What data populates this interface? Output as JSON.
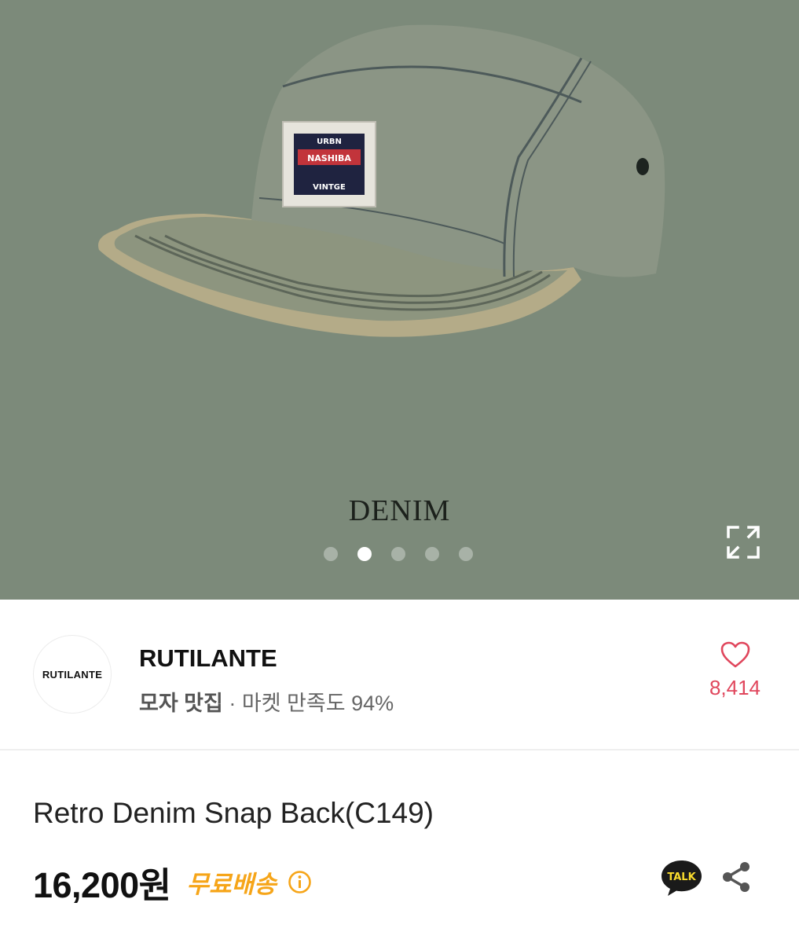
{
  "hero": {
    "caption": "DENIM",
    "patch_top": "URBN",
    "patch_mid": "NASHIBA",
    "patch_bottom": "VINTGE",
    "slides_total": 5,
    "active_slide": 2,
    "background": "#7c8a7a"
  },
  "shop": {
    "logo_text": "RUTILANTE",
    "name": "RUTILANTE",
    "category": "모자 맛집",
    "separator": " · ",
    "satisfaction": "마켓 만족도 94%",
    "like_count": "8,414",
    "like_color": "#e0465c"
  },
  "product": {
    "title": "Retro Denim Snap Back(C149)",
    "price": "16,200원",
    "shipping": "무료배송",
    "shipping_color": "#f6a519"
  },
  "icons": {
    "expand": "expand-icon",
    "heart": "heart-icon",
    "info": "info-icon",
    "talk": "kakao-talk-icon",
    "talk_label": "TALK",
    "share": "share-icon"
  }
}
